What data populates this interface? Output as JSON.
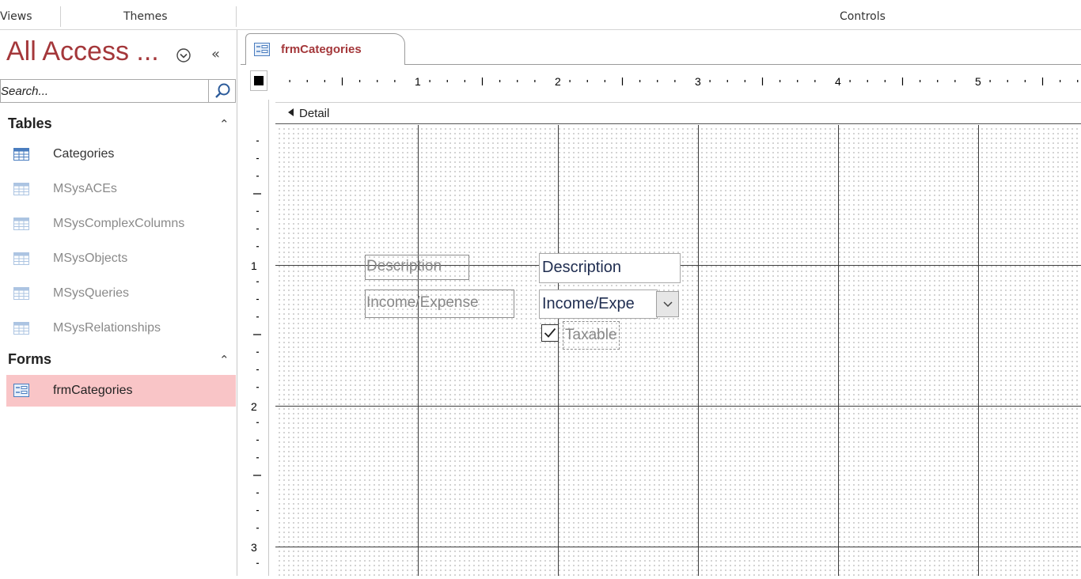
{
  "ribbon": {
    "groups": [
      "Views",
      "Themes",
      "Controls"
    ]
  },
  "nav": {
    "title": "All Access ...",
    "search_placeholder": "Search...",
    "sections": [
      {
        "label": "Tables",
        "items": [
          {
            "label": "Categories",
            "dim": false
          },
          {
            "label": "MSysACEs",
            "dim": true
          },
          {
            "label": "MSysComplexColumns",
            "dim": true
          },
          {
            "label": "MSysObjects",
            "dim": true
          },
          {
            "label": "MSysQueries",
            "dim": true
          },
          {
            "label": "MSysRelationships",
            "dim": true
          }
        ]
      },
      {
        "label": "Forms",
        "items": [
          {
            "label": "frmCategories",
            "selected": true
          }
        ]
      }
    ]
  },
  "document": {
    "tab_label": "frmCategories",
    "section_label": "Detail",
    "hruler_numbers": [
      "1",
      "2",
      "3",
      "4",
      "5"
    ],
    "vruler_numbers": [
      "1",
      "2",
      "3"
    ],
    "controls": {
      "description_label": "Description",
      "description_field": "Description",
      "income_label": "Income/Expense",
      "income_combo": "Income/Expe",
      "taxable_label": "Taxable",
      "taxable_checked": true
    }
  },
  "colors": {
    "accent": "#a4373a",
    "selected_bg": "#f9c5c7",
    "dim_text": "#8a8a8a",
    "table_icon": "#4a7dbf"
  }
}
